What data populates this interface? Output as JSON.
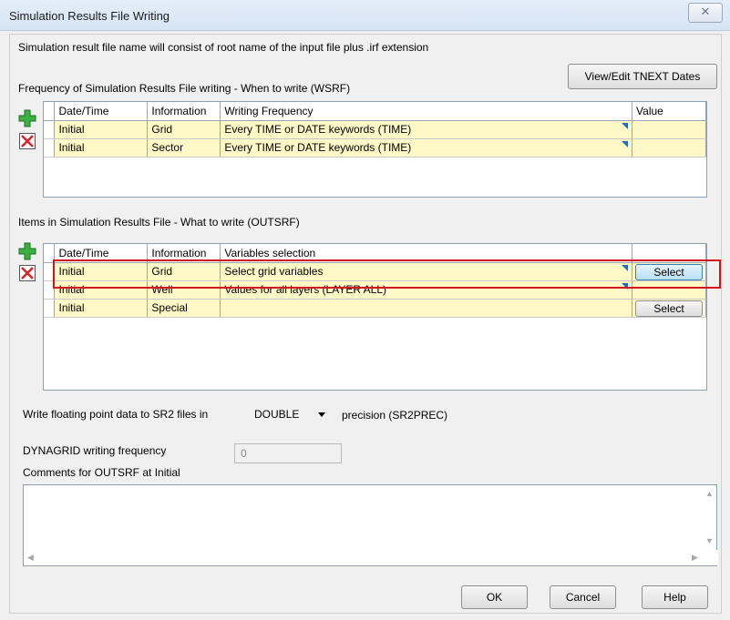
{
  "window": {
    "title": "Simulation Results File Writing",
    "close_glyph": "✕"
  },
  "info_text": "Simulation result file name will consist of root name of the input file plus .irf extension",
  "view_edit_button": "View/Edit TNEXT Dates",
  "wsrf": {
    "heading": "Frequency of Simulation Results File writing -  When to write (WSRF)",
    "columns": [
      "Date/Time",
      "Information",
      "Writing Frequency",
      "Value"
    ],
    "rows": [
      {
        "date": "Initial",
        "info": "Grid",
        "freq": "Every TIME or DATE keywords (TIME)",
        "value": ""
      },
      {
        "date": "Initial",
        "info": "Sector",
        "freq": "Every TIME or DATE keywords (TIME)",
        "value": ""
      }
    ]
  },
  "outsrf": {
    "heading": "Items in Simulation Results File - What to write (OUTSRF)",
    "columns": [
      "Date/Time",
      "Information",
      "Variables selection",
      ""
    ],
    "rows": [
      {
        "date": "Initial",
        "info": "Grid",
        "selection": "Select grid variables",
        "button": "Select"
      },
      {
        "date": "Initial",
        "info": "Well",
        "selection": "Values for all layers (LAYER ALL)",
        "button": ""
      },
      {
        "date": "Initial",
        "info": "Special",
        "selection": "",
        "button": "Select"
      }
    ]
  },
  "precision": {
    "label": "Write floating point data to SR2 files in",
    "value": "DOUBLE",
    "suffix": "precision (SR2PREC)"
  },
  "dynagrid": {
    "label": "DYNAGRID writing frequency",
    "value": "0"
  },
  "comments": {
    "label": "Comments for OUTSRF at Initial",
    "value": ""
  },
  "buttons": {
    "ok": "OK",
    "cancel": "Cancel",
    "help": "Help"
  },
  "colors": {
    "highlight": "#d6141d",
    "row_fill": "#fff9c8",
    "dropdown_marker": "#1f6fc8"
  }
}
